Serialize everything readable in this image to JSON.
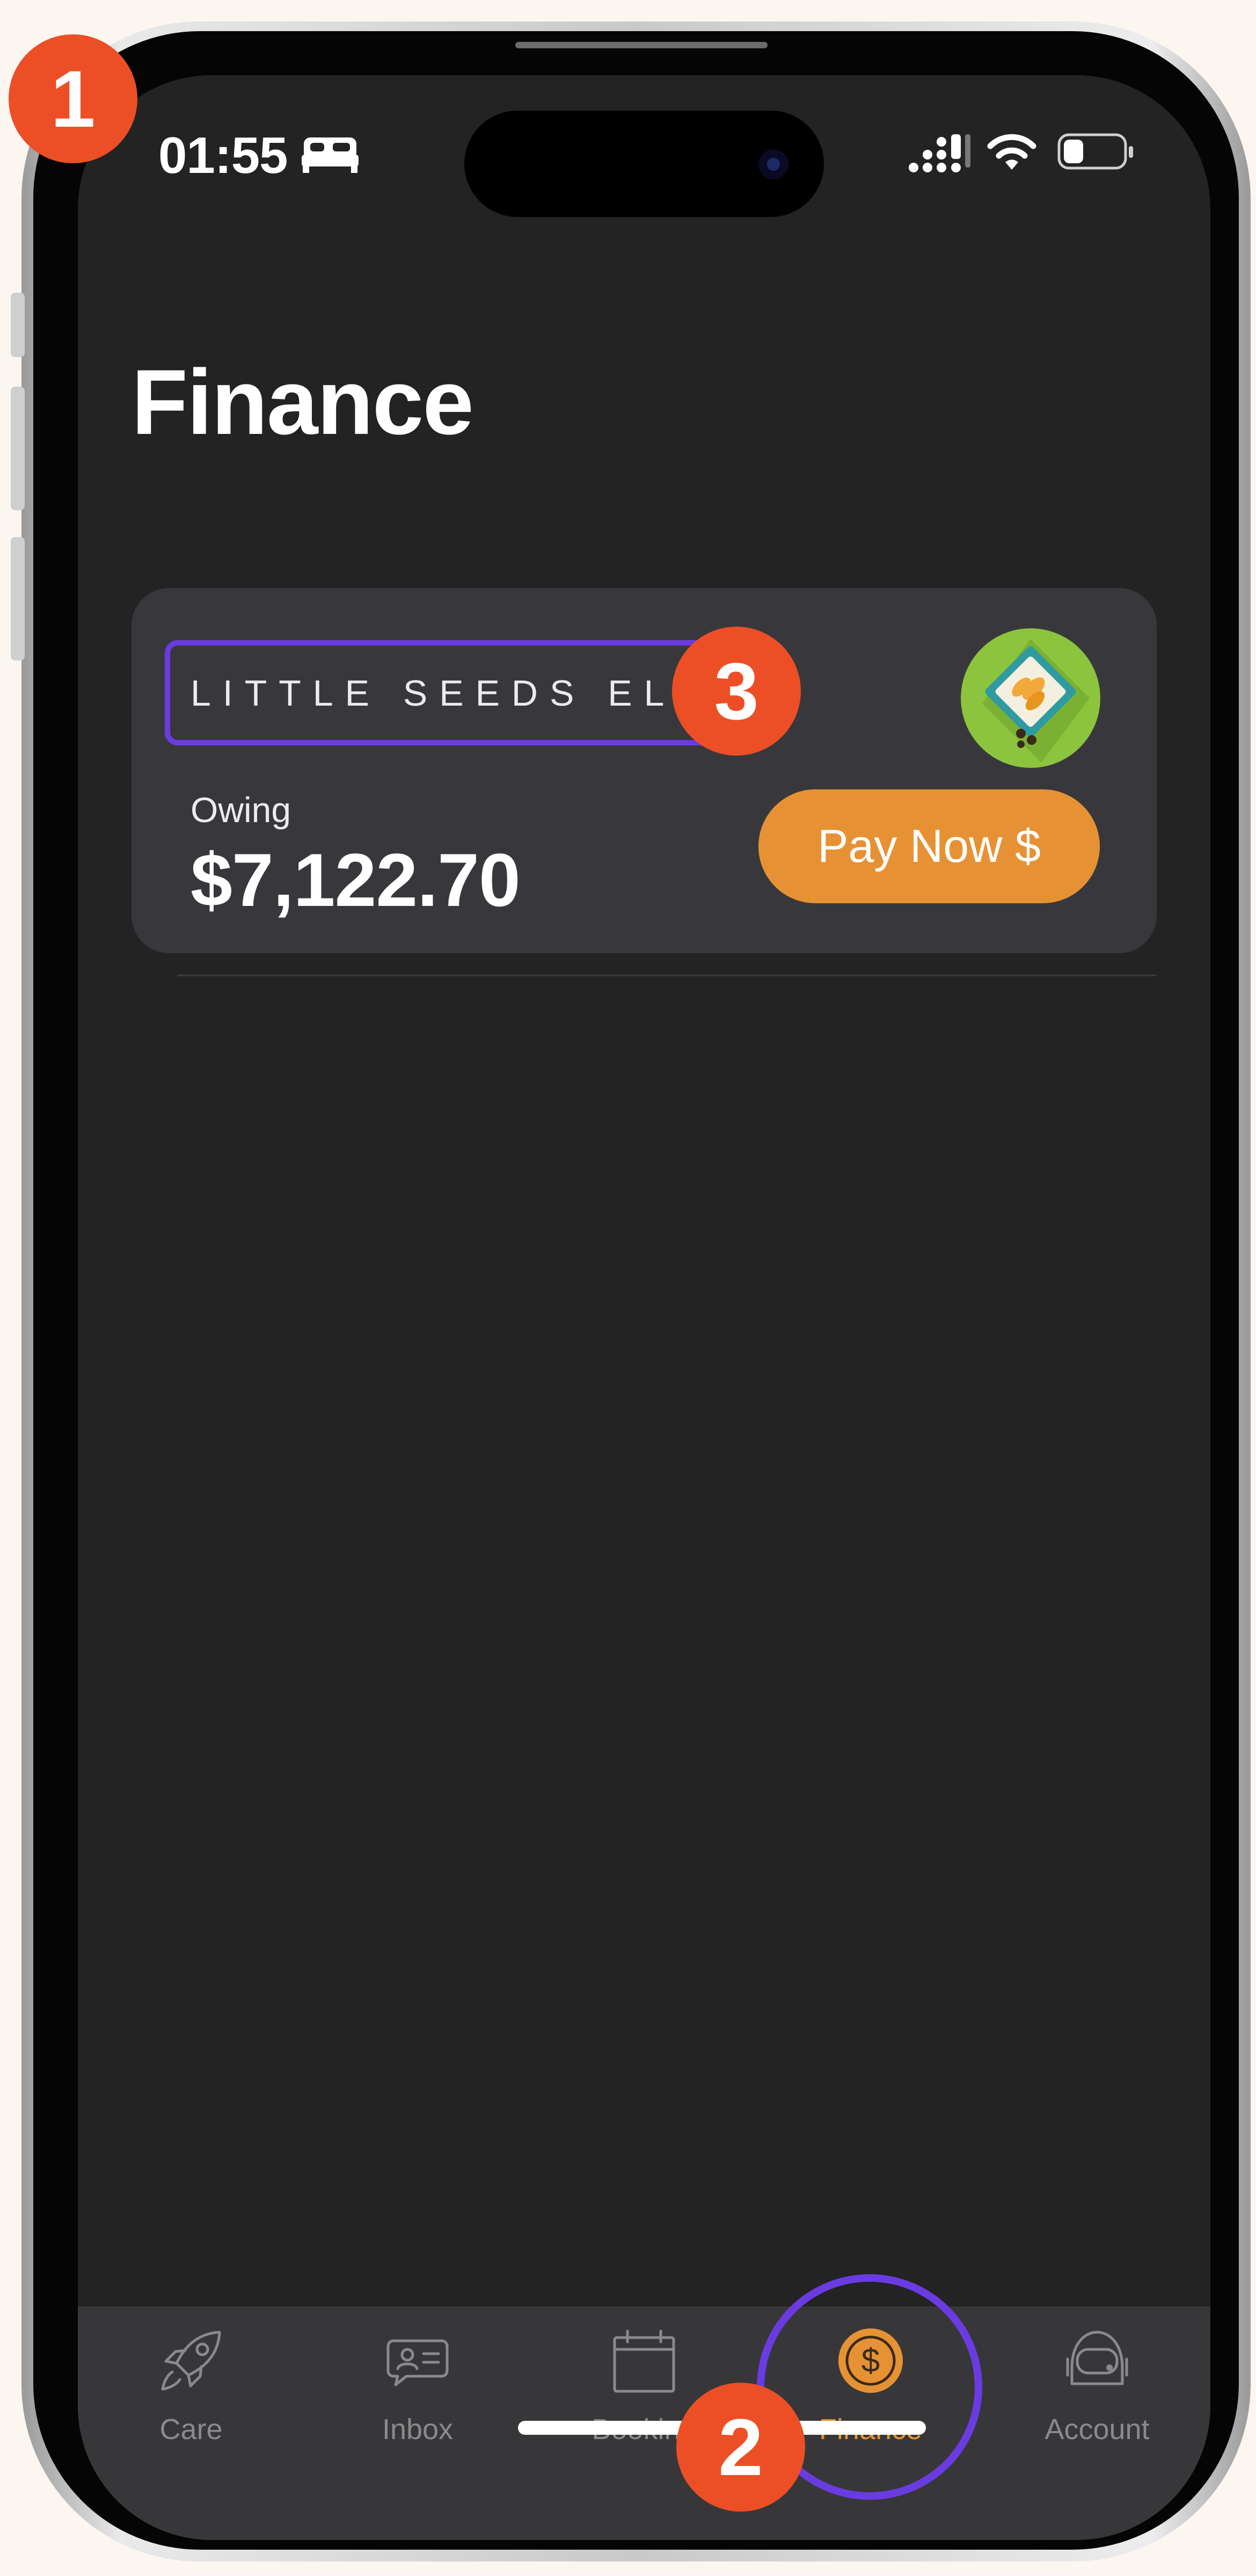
{
  "status_bar": {
    "time": "01:55",
    "icons": [
      "bed-icon",
      "signal-icon",
      "wifi-icon",
      "battery-icon"
    ]
  },
  "page": {
    "title": "Finance"
  },
  "account_card": {
    "provider_name": "LITTLE SEEDS ELC",
    "owing_label": "Owing",
    "owing_amount": "$7,122.70",
    "pay_button_label": "Pay Now $"
  },
  "tab_bar": {
    "active": "Finance",
    "items": [
      {
        "label": "Care",
        "icon": "rocket-icon"
      },
      {
        "label": "Inbox",
        "icon": "contact-card-icon"
      },
      {
        "label": "Booking",
        "icon": "calendar-icon"
      },
      {
        "label": "Finance",
        "icon": "dollar-circle-icon"
      },
      {
        "label": "Account",
        "icon": "astronaut-helmet-icon"
      }
    ]
  },
  "annotations": {
    "badge_1": "1",
    "badge_2": "2",
    "badge_3": "3"
  },
  "colors": {
    "accent": "#e69234",
    "annotation_badge": "#ec4f26",
    "annotation_outline": "#6b3be2",
    "background": "#232323",
    "card": "#38383c",
    "tab_bar": "#373739",
    "inactive_tab": "#8a8a8c"
  }
}
